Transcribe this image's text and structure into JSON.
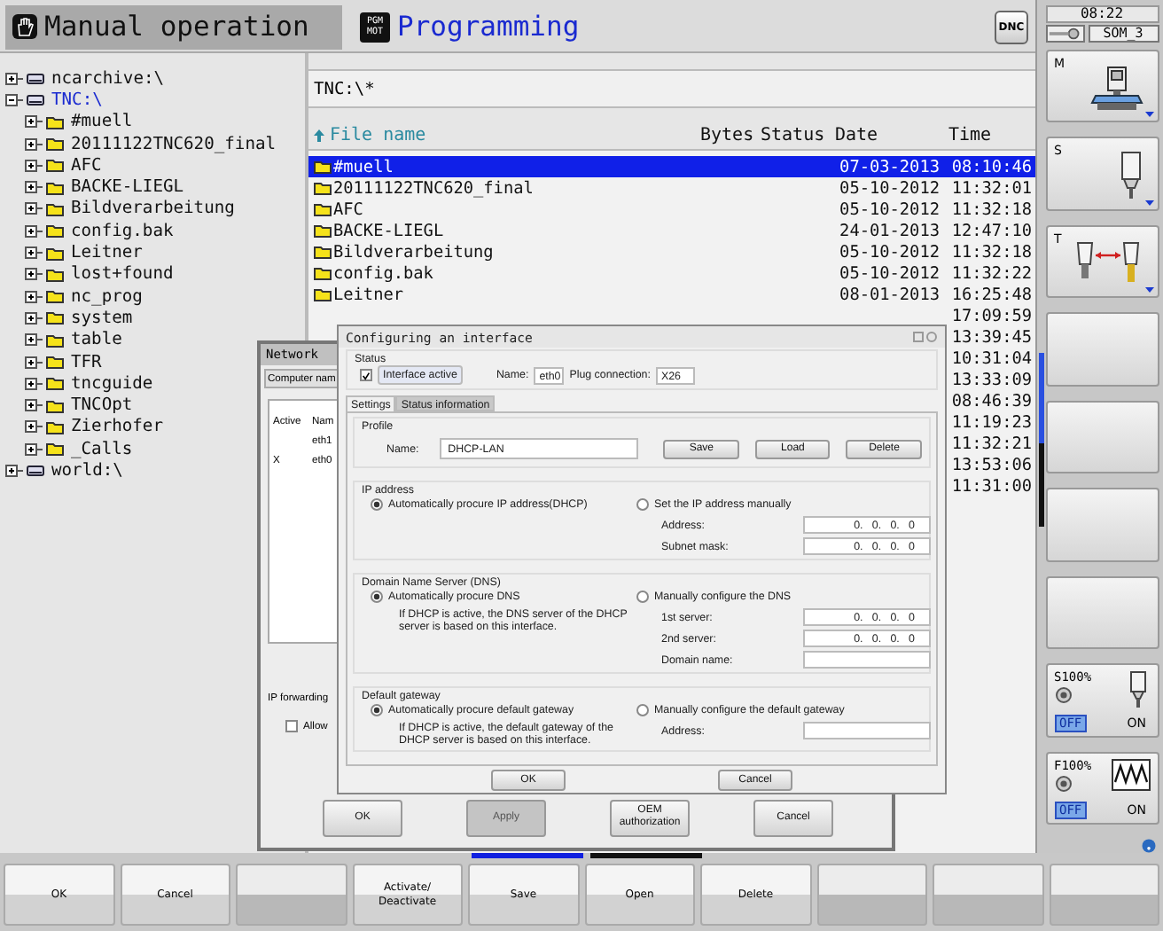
{
  "header": {
    "modes": [
      {
        "label": "Manual operation",
        "selected": true,
        "kind": "manual"
      },
      {
        "label": "Programming",
        "selected": false,
        "kind": "program"
      }
    ],
    "badge_lines": [
      "PGM",
      "MOT"
    ],
    "dnc": "DNC"
  },
  "tree": [
    {
      "label": "ncarchive:\\",
      "kind": "drive",
      "expanded": false,
      "selected": false
    },
    {
      "label": "TNC:\\",
      "kind": "drive",
      "expanded": true,
      "selected": true,
      "children": [
        {
          "label": "#muell",
          "kind": "folder",
          "expanded": false,
          "selected": false
        },
        {
          "label": "20111122TNC620_final",
          "kind": "folder",
          "expanded": false,
          "selected": false
        },
        {
          "label": "AFC",
          "kind": "folder",
          "expanded": false,
          "selected": false
        },
        {
          "label": "BACKE-LIEGL",
          "kind": "folder",
          "expanded": false,
          "selected": false
        },
        {
          "label": "Bildverarbeitung",
          "kind": "folder",
          "expanded": false,
          "selected": false
        },
        {
          "label": "config.bak",
          "kind": "folder",
          "expanded": false,
          "selected": false
        },
        {
          "label": "Leitner",
          "kind": "folder",
          "expanded": false,
          "selected": false
        },
        {
          "label": "lost+found",
          "kind": "folder",
          "expanded": false,
          "selected": false
        },
        {
          "label": "nc_prog",
          "kind": "folder",
          "expanded": false,
          "selected": false
        },
        {
          "label": "system",
          "kind": "folder",
          "expanded": false,
          "selected": false
        },
        {
          "label": "table",
          "kind": "folder",
          "expanded": false,
          "selected": false
        },
        {
          "label": "TFR",
          "kind": "folder",
          "expanded": false,
          "selected": false
        },
        {
          "label": "tncguide",
          "kind": "folder",
          "expanded": false,
          "selected": false
        },
        {
          "label": "TNCOpt",
          "kind": "folder",
          "expanded": false,
          "selected": false
        },
        {
          "label": "Zierhofer",
          "kind": "folder",
          "expanded": false,
          "selected": false
        },
        {
          "label": "_Calls",
          "kind": "folder",
          "expanded": false,
          "selected": false
        }
      ]
    },
    {
      "label": "world:\\",
      "kind": "drive",
      "expanded": false,
      "selected": false
    }
  ],
  "files": {
    "path": "TNC:\\*",
    "columns": [
      "File name",
      "Bytes",
      "Status",
      "Date",
      "Time"
    ],
    "rows": [
      {
        "name": "#muell",
        "date": "07-03-2013",
        "time": "08:10:46",
        "selected": true
      },
      {
        "name": "20111122TNC620_final",
        "date": "05-10-2012",
        "time": "11:32:01",
        "selected": false
      },
      {
        "name": "AFC",
        "date": "05-10-2012",
        "time": "11:32:18",
        "selected": false
      },
      {
        "name": "BACKE-LIEGL",
        "date": "24-01-2013",
        "time": "12:47:10",
        "selected": false
      },
      {
        "name": "Bildverarbeitung",
        "date": "05-10-2012",
        "time": "11:32:18",
        "selected": false
      },
      {
        "name": "config.bak",
        "date": "05-10-2012",
        "time": "11:32:22",
        "selected": false
      },
      {
        "name": "Leitner",
        "date": "08-01-2013",
        "time": "16:25:48",
        "selected": false
      },
      {
        "time": "17:09:59",
        "selected": false
      },
      {
        "time": "13:39:45",
        "selected": false
      },
      {
        "time": "10:31:04",
        "selected": false
      },
      {
        "time": "13:33:09",
        "selected": false
      },
      {
        "time": "08:46:39",
        "selected": false
      },
      {
        "time": "11:19:23",
        "selected": false
      },
      {
        "time": "11:32:21",
        "selected": false
      },
      {
        "time": "13:53:06",
        "selected": false
      },
      {
        "time": "11:31:00",
        "selected": false
      }
    ]
  },
  "network_dialog": {
    "title": "Network",
    "tab": "Computer nam",
    "columns": [
      "Active",
      "Nam"
    ],
    "rows": [
      {
        "name": "eth1"
      },
      {
        "active": "X",
        "name": "eth0"
      }
    ],
    "ip_forwarding": "IP forwarding",
    "allow": {
      "label": "Allow",
      "checked": false
    },
    "buttons": [
      {
        "label": "OK",
        "disabled": false
      },
      {
        "label": "Apply",
        "disabled": true
      },
      {
        "label": "OEM authorization",
        "disabled": false
      },
      {
        "label": "Cancel",
        "disabled": false
      }
    ]
  },
  "config_dialog": {
    "title": "Configuring an interface",
    "status": {
      "heading": "Status",
      "active_label": "Interface active",
      "active": true,
      "name_label": "Name:",
      "name": "eth0",
      "plug_label": "Plug connection:",
      "plug": "X26"
    },
    "tabs": [
      {
        "label": "Settings",
        "selected": true
      },
      {
        "label": "Status information",
        "selected": false
      }
    ],
    "profile": {
      "heading": "Profile",
      "name_label": "Name:",
      "name": "DHCP-LAN",
      "buttons": [
        "Save",
        "Load",
        "Delete"
      ]
    },
    "sections": [
      {
        "heading": "IP address",
        "options": [
          {
            "label": "Automatically procure IP address(DHCP)",
            "selected": true
          },
          {
            "label": "Set the IP address manually",
            "selected": false
          }
        ],
        "fields": [
          {
            "label": "Address:",
            "value": "0.   0.   0.   0"
          },
          {
            "label": "Subnet mask:",
            "value": "0.   0.   0.   0"
          }
        ]
      },
      {
        "heading": "Domain Name Server (DNS)",
        "options": [
          {
            "label": "Automatically procure DNS",
            "selected": true
          },
          {
            "label": "Manually configure the DNS",
            "selected": false
          }
        ],
        "note": "If DHCP is active, the DNS server of the DHCP server is based on this interface.",
        "fields": [
          {
            "label": "1st server:",
            "value": "0.   0.   0.   0"
          },
          {
            "label": "2nd server:",
            "value": "0.   0.   0.   0"
          },
          {
            "label": "Domain name:"
          }
        ]
      },
      {
        "heading": "Default gateway",
        "options": [
          {
            "label": "Automatically procure default gateway",
            "selected": true
          },
          {
            "label": "Manually configure the default gateway",
            "selected": false
          }
        ],
        "note": "If DHCP is active, the default gateway of the DHCP server is based on this interface.",
        "fields": [
          {
            "label": "Address:"
          }
        ]
      }
    ],
    "buttons": [
      "OK",
      "Cancel"
    ]
  },
  "sidebar": {
    "clock": "08:22",
    "user": "SOM_3",
    "keys": [
      {
        "kind": "machine",
        "label": "M"
      },
      {
        "kind": "spindle",
        "label": "S"
      },
      {
        "kind": "tool",
        "label": "T"
      },
      {
        "kind": "blank"
      },
      {
        "kind": "blank"
      },
      {
        "kind": "blank"
      },
      {
        "kind": "blank"
      },
      {
        "kind": "spindle_override",
        "label": "S100%",
        "options": [
          {
            "label": "OFF",
            "selected": true
          },
          {
            "label": "ON",
            "selected": false
          }
        ]
      },
      {
        "kind": "feed_override",
        "label": "F100%",
        "options": [
          {
            "label": "OFF",
            "selected": true
          },
          {
            "label": "ON",
            "selected": false
          }
        ]
      }
    ]
  },
  "softkeys": [
    {
      "kind": "key",
      "label": "OK"
    },
    {
      "kind": "key",
      "label": "Cancel"
    },
    {
      "kind": "blank"
    },
    {
      "kind": "key",
      "label": "Activate/ Deactivate"
    },
    {
      "kind": "key",
      "label": "Save"
    },
    {
      "kind": "key",
      "label": "Open"
    },
    {
      "kind": "key",
      "label": "Delete"
    },
    {
      "kind": "blank"
    },
    {
      "kind": "blank"
    },
    {
      "kind": "blank"
    }
  ]
}
